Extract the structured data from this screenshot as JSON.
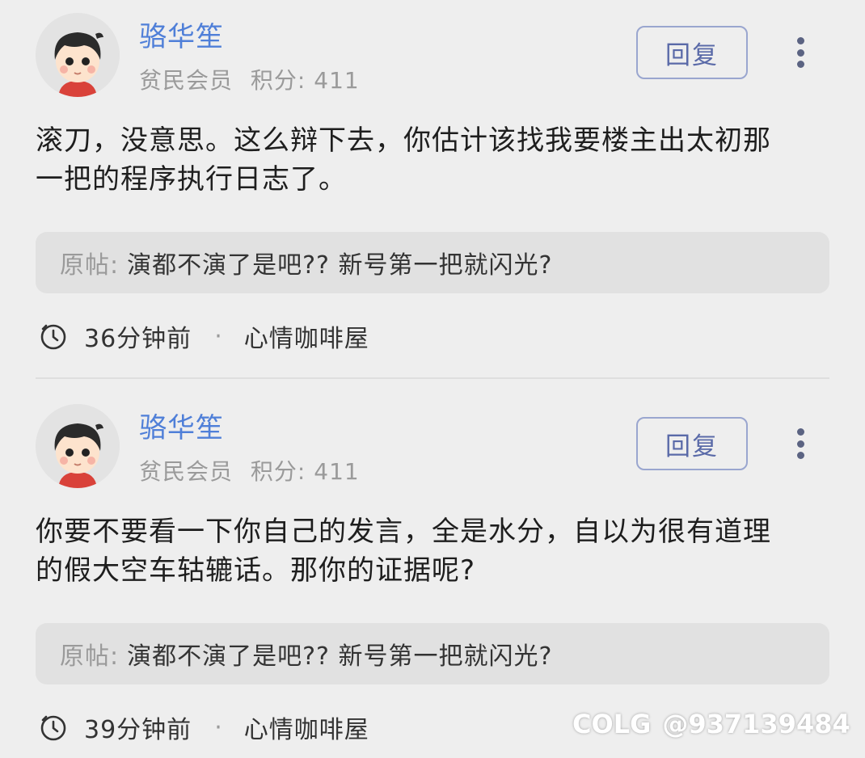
{
  "posts": [
    {
      "username": "骆华笙",
      "member_level": "贫民会员",
      "points_label": "积分:",
      "points": "411",
      "reply_label": "回复",
      "content_lines": [
        "滚刀，没意思。这么辩下去，你估计该找我要楼主出太初那",
        "一把的程序执行日志了。"
      ],
      "quote_prefix": "原帖:",
      "quote_text": "演都不演了是吧?? 新号第一把就闪光?",
      "time": "36分钟前",
      "separator": "·",
      "forum": "心情咖啡屋"
    },
    {
      "username": "骆华笙",
      "member_level": "贫民会员",
      "points_label": "积分:",
      "points": "411",
      "reply_label": "回复",
      "content_lines": [
        "你要不要看一下你自己的发言，全是水分，自以为很有道理",
        "的假大空车轱辘话。那你的证据呢?"
      ],
      "quote_prefix": "原帖:",
      "quote_text": "演都不演了是吧?? 新号第一把就闪光?",
      "time": "39分钟前",
      "separator": "·",
      "forum": "心情咖啡屋"
    }
  ],
  "watermark": {
    "logo": "COLG",
    "handle": "@937139484"
  },
  "colors": {
    "background": "#eeeeee",
    "username": "#4f7fd8",
    "reply_border": "#9aa6cf",
    "quote_bg": "#e1e1e1"
  },
  "icons": [
    "avatar",
    "more-vertical-icon",
    "clock-icon"
  ]
}
